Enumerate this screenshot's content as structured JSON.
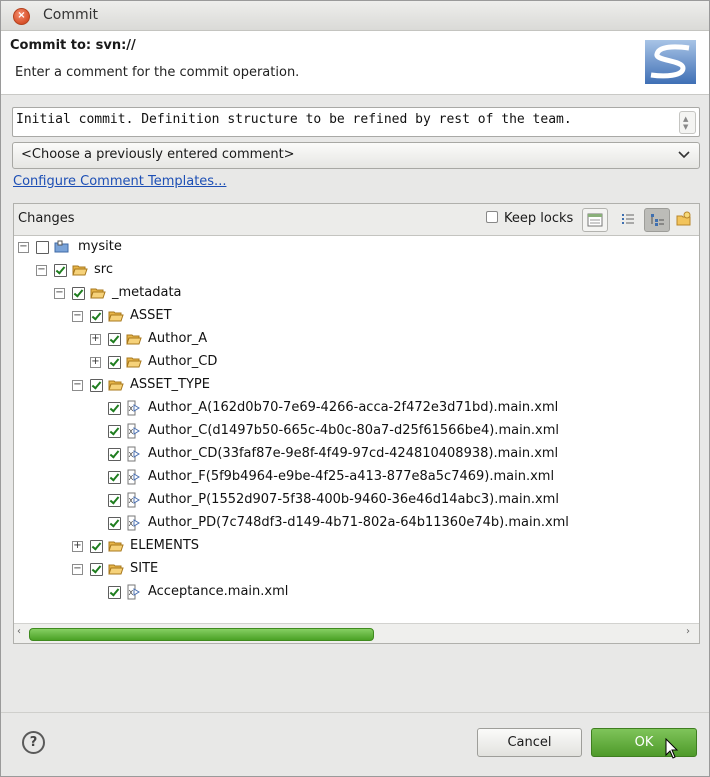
{
  "window": {
    "title": "Commit",
    "close_icon": "close-icon"
  },
  "header": {
    "title": "Commit to: svn://",
    "description": "Enter a comment for the commit operation.",
    "logo": "svn-logo"
  },
  "comment": {
    "value": "Initial commit. Definition structure to be refined by rest of the team.",
    "previous_combo": "<Choose a previously entered comment>",
    "templates_link": "Configure Comment Templates..."
  },
  "changes": {
    "title": "Changes",
    "keep_locks_label": "Keep locks",
    "keep_locks_checked": false,
    "tree": [
      {
        "label": "mysite",
        "expanded": true,
        "checked": false,
        "icon": "project-icon"
      },
      {
        "label": "src",
        "expanded": true,
        "checked": true,
        "icon": "folder-icon"
      },
      {
        "label": "_metadata",
        "expanded": true,
        "checked": true,
        "icon": "folder-icon"
      },
      {
        "label": "ASSET",
        "expanded": true,
        "checked": true,
        "icon": "folder-icon"
      },
      {
        "label": "Author_A",
        "expanded": false,
        "checked": true,
        "icon": "folder-icon"
      },
      {
        "label": "Author_CD",
        "expanded": false,
        "checked": true,
        "icon": "folder-icon"
      },
      {
        "label": "ASSET_TYPE",
        "expanded": true,
        "checked": true,
        "icon": "folder-icon"
      },
      {
        "label": "Author_A(162d0b70-7e69-4266-acca-2f472e3d71bd).main.xml",
        "checked": true,
        "icon": "xml-file-icon"
      },
      {
        "label": "Author_C(d1497b50-665c-4b0c-80a7-d25f61566be4).main.xml",
        "checked": true,
        "icon": "xml-file-icon"
      },
      {
        "label": "Author_CD(33faf87e-9e8f-4f49-97cd-424810408938).main.xml",
        "checked": true,
        "icon": "xml-file-icon"
      },
      {
        "label": "Author_F(5f9b4964-e9be-4f25-a413-877e8a5c7469).main.xml",
        "checked": true,
        "icon": "xml-file-icon"
      },
      {
        "label": "Author_P(1552d907-5f38-400b-9460-36e46d14abc3).main.xml",
        "checked": true,
        "icon": "xml-file-icon"
      },
      {
        "label": "Author_PD(7c748df3-d149-4b71-802a-64b11360e74b).main.xml",
        "checked": true,
        "icon": "xml-file-icon"
      },
      {
        "label": "ELEMENTS",
        "expanded": false,
        "checked": true,
        "icon": "folder-icon"
      },
      {
        "label": "SITE",
        "expanded": true,
        "checked": true,
        "icon": "folder-icon"
      },
      {
        "label": "Acceptance.main.xml",
        "checked": true,
        "icon": "xml-file-icon"
      }
    ],
    "scroll_position": 0.5
  },
  "buttons": {
    "cancel": "Cancel",
    "ok": "OK",
    "help": "?"
  },
  "colors": {
    "ok_button": "#5aa735",
    "link": "#1d4fb5",
    "scroll_thumb": "#5cb234"
  }
}
